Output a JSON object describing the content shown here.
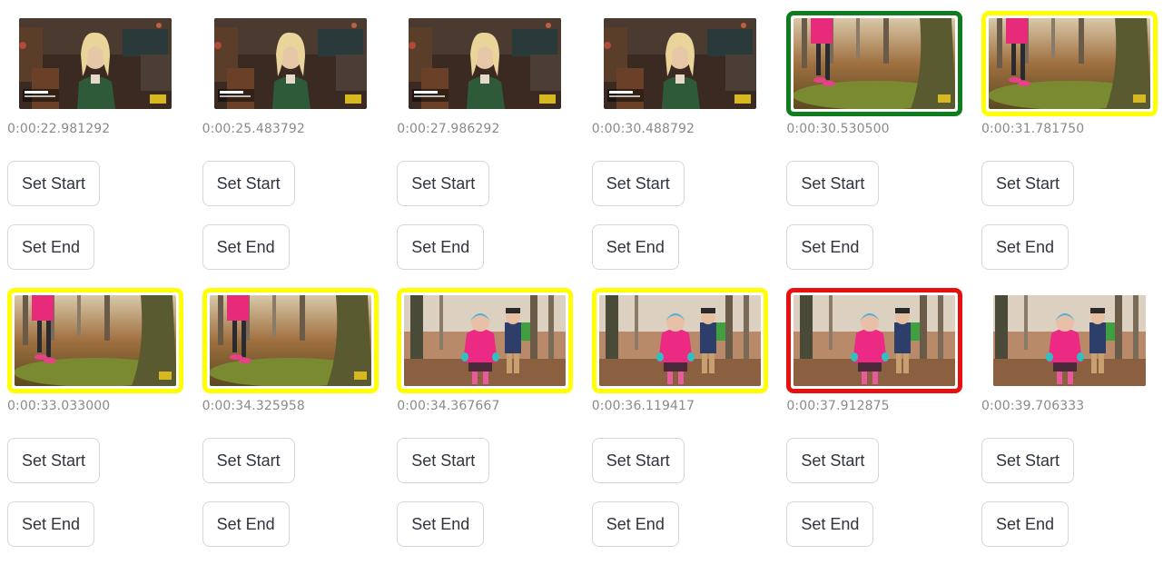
{
  "frames": [
    {
      "timestamp": "0:00:22.981292",
      "selection": "none",
      "scene": "interview",
      "set_start_label": "Set Start",
      "set_end_label": "Set End"
    },
    {
      "timestamp": "0:00:25.483792",
      "selection": "none",
      "scene": "interview",
      "set_start_label": "Set Start",
      "set_end_label": "Set End"
    },
    {
      "timestamp": "0:00:27.986292",
      "selection": "none",
      "scene": "interview",
      "set_start_label": "Set Start",
      "set_end_label": "Set End"
    },
    {
      "timestamp": "0:00:30.488792",
      "selection": "none",
      "scene": "interview",
      "set_start_label": "Set Start",
      "set_end_label": "Set End"
    },
    {
      "timestamp": "0:00:30.530500",
      "selection": "green",
      "scene": "forest-feet",
      "set_start_label": "Set Start",
      "set_end_label": "Set End"
    },
    {
      "timestamp": "0:00:31.781750",
      "selection": "yellow",
      "scene": "forest-feet",
      "set_start_label": "Set Start",
      "set_end_label": "Set End"
    },
    {
      "timestamp": "0:00:33.033000",
      "selection": "yellow",
      "scene": "forest-feet",
      "set_start_label": "Set Start",
      "set_end_label": "Set End"
    },
    {
      "timestamp": "0:00:34.325958",
      "selection": "yellow",
      "scene": "forest-feet",
      "set_start_label": "Set Start",
      "set_end_label": "Set End"
    },
    {
      "timestamp": "0:00:34.367667",
      "selection": "yellow",
      "scene": "forest-kids",
      "set_start_label": "Set Start",
      "set_end_label": "Set End"
    },
    {
      "timestamp": "0:00:36.119417",
      "selection": "yellow",
      "scene": "forest-kids",
      "set_start_label": "Set Start",
      "set_end_label": "Set End"
    },
    {
      "timestamp": "0:00:37.912875",
      "selection": "red",
      "scene": "forest-kids",
      "set_start_label": "Set Start",
      "set_end_label": "Set End"
    },
    {
      "timestamp": "0:00:39.706333",
      "selection": "none",
      "scene": "forest-kids",
      "set_start_label": "Set Start",
      "set_end_label": "Set End"
    }
  ],
  "colors": {
    "green": "#0e7d1e",
    "yellow": "#ffff00",
    "red": "#e8100e",
    "timestamp_text": "#8a8a8a",
    "button_text": "#31333f",
    "button_border": "#d6d6d6"
  }
}
